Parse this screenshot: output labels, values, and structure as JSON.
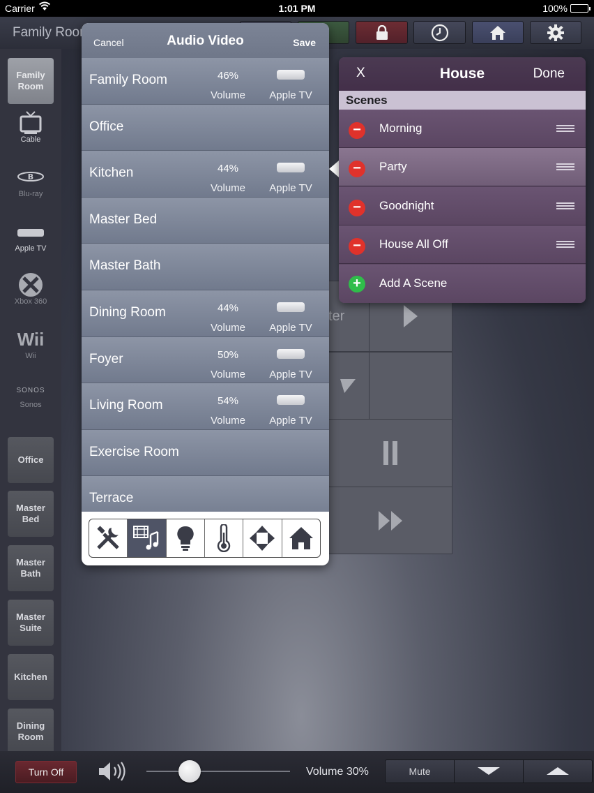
{
  "status_bar": {
    "carrier": "Carrier",
    "wifi_icon": "wifi-icon",
    "time": "1:01 PM",
    "battery_pct": "100%"
  },
  "top_bar": {
    "room_title": "Family Room",
    "buttons": [
      {
        "name": "lock-icon",
        "glyph": "🔒"
      },
      {
        "name": "clock-icon",
        "glyph": "🕐"
      },
      {
        "name": "home-icon",
        "glyph": "⌂"
      },
      {
        "name": "gear-icon",
        "glyph": "⚙"
      }
    ]
  },
  "sidebar": {
    "rooms_top": [
      {
        "label": "Family\nRoom",
        "active": true
      }
    ],
    "sources": [
      {
        "label": "Cable",
        "icon": "tv-icon",
        "glyph": "📺"
      },
      {
        "label": "Blu-ray",
        "icon": "bluray-icon",
        "glyph": "◉"
      },
      {
        "label": "Apple TV",
        "icon": "appletv-icon",
        "glyph": "▬"
      },
      {
        "label": "Xbox 360",
        "icon": "xbox-icon",
        "glyph": "✖"
      },
      {
        "label": "Wii",
        "icon": "wii-icon",
        "glyph": "Wii"
      },
      {
        "label": "Sonos",
        "icon": "sonos-icon",
        "glyph": "SONOS"
      }
    ],
    "rooms": [
      "Office",
      "Master\nBed",
      "Master\nBath",
      "Master\nSuite",
      "Kitchen",
      "Dining\nRoom"
    ]
  },
  "av_panel": {
    "cancel": "Cancel",
    "title": "Audio Video",
    "save": "Save",
    "rows": [
      {
        "name": "Family Room",
        "pct": "46%",
        "vol_label": "Volume",
        "source": "Apple TV"
      },
      {
        "name": "Office"
      },
      {
        "name": "Kitchen",
        "pct": "44%",
        "vol_label": "Volume",
        "source": "Apple TV"
      },
      {
        "name": "Master Bed"
      },
      {
        "name": "Master Bath"
      },
      {
        "name": "Dining Room",
        "pct": "44%",
        "vol_label": "Volume",
        "source": "Apple TV"
      },
      {
        "name": "Foyer",
        "pct": "50%",
        "vol_label": "Volume",
        "source": "Apple TV"
      },
      {
        "name": "Living Room",
        "pct": "54%",
        "vol_label": "Volume",
        "source": "Apple TV"
      },
      {
        "name": "Exercise Room"
      },
      {
        "name": "Terrace"
      }
    ],
    "tabs": [
      {
        "name": "tools-icon",
        "glyph": "⚒",
        "active": false
      },
      {
        "name": "media-icon",
        "glyph": "🎞",
        "active": true
      },
      {
        "name": "lightbulb-icon",
        "glyph": "💡",
        "active": false
      },
      {
        "name": "thermometer-icon",
        "glyph": "🌡",
        "active": false
      },
      {
        "name": "shades-icon",
        "glyph": "◈",
        "active": false
      },
      {
        "name": "house-icon",
        "glyph": "⌂",
        "active": false
      }
    ]
  },
  "house_panel": {
    "close": "X",
    "title": "House",
    "done": "Done",
    "section": "Scenes",
    "scenes": [
      {
        "name": "Morning",
        "selected": false
      },
      {
        "name": "Party",
        "selected": true
      },
      {
        "name": "Goodnight",
        "selected": false
      },
      {
        "name": "House All Off",
        "selected": false
      }
    ],
    "add_scene": "Add A Scene"
  },
  "background": {
    "partial_label": "ter"
  },
  "bottom_bar": {
    "turn_off": "Turn Off",
    "volume_text": "Volume 30%",
    "volume_level": 0.3,
    "mute": "Mute"
  },
  "colors": {
    "accent_red": "#e0322b",
    "accent_green": "#2fbd4a",
    "house_purple": "#5c4863",
    "av_blue": "#7c8496"
  }
}
